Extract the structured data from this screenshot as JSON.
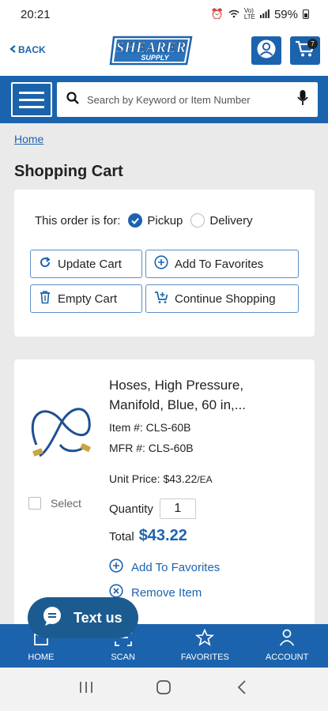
{
  "status_bar": {
    "time": "20:21",
    "battery": "59%"
  },
  "header": {
    "back_label": "BACK",
    "logo_top": "SHEARER",
    "logo_bottom": "SUPPLY",
    "cart_count": "7"
  },
  "search": {
    "placeholder": "Search by Keyword or Item Number"
  },
  "breadcrumb": {
    "home": "Home"
  },
  "page": {
    "title": "Shopping Cart"
  },
  "order": {
    "label": "This order is for:",
    "options": [
      "Pickup",
      "Delivery"
    ],
    "selected": "Pickup",
    "buttons": {
      "update": "Update Cart",
      "favorites": "Add To Favorites",
      "empty": "Empty Cart",
      "continue": "Continue Shopping"
    }
  },
  "item": {
    "name_line1": "Hoses, High Pressure,",
    "name_line2": "Manifold, Blue, 60 in,...",
    "item_no": "Item #: CLS-60B",
    "mfr_no": "MFR #: CLS-60B",
    "unit_price_label": "Unit Price: ",
    "unit_price": "$43.22",
    "unit": "/EA",
    "quantity_label": "Quantity",
    "quantity": "1",
    "total_label": "Total",
    "total": "$43.22",
    "select_label": "Select",
    "add_favorites": "Add To Favorites",
    "remove": "Remove Item"
  },
  "chat": {
    "label": "Text us"
  },
  "bottom_nav": [
    "HOME",
    "SCAN",
    "FAVORITES",
    "ACCOUNT"
  ],
  "colors": {
    "primary": "#1c63ad",
    "chat": "#1c5b8f"
  }
}
